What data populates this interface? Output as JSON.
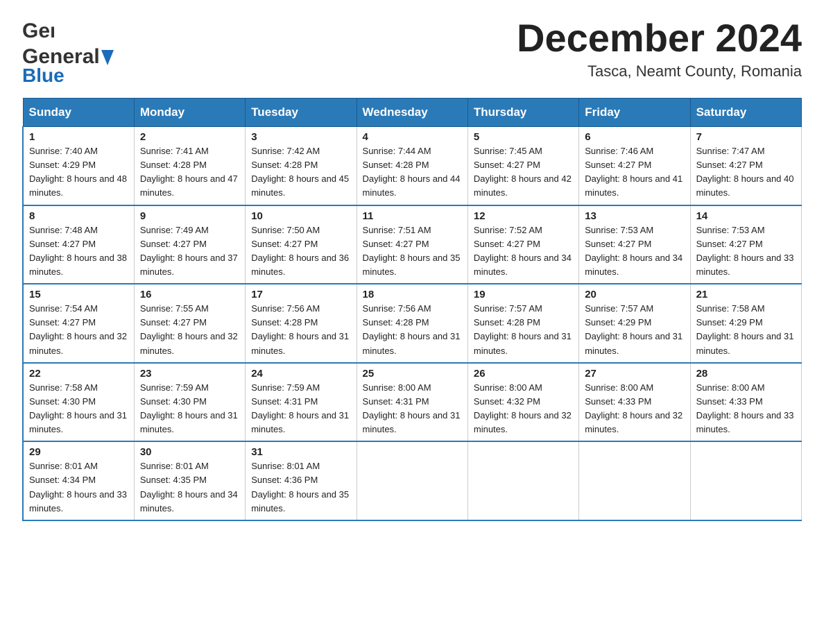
{
  "header": {
    "logo_line1": "General",
    "logo_line2": "Blue",
    "title": "December 2024",
    "subtitle": "Tasca, Neamt County, Romania"
  },
  "weekdays": [
    "Sunday",
    "Monday",
    "Tuesday",
    "Wednesday",
    "Thursday",
    "Friday",
    "Saturday"
  ],
  "weeks": [
    [
      {
        "day": "1",
        "sunrise": "7:40 AM",
        "sunset": "4:29 PM",
        "daylight": "8 hours and 48 minutes."
      },
      {
        "day": "2",
        "sunrise": "7:41 AM",
        "sunset": "4:28 PM",
        "daylight": "8 hours and 47 minutes."
      },
      {
        "day": "3",
        "sunrise": "7:42 AM",
        "sunset": "4:28 PM",
        "daylight": "8 hours and 45 minutes."
      },
      {
        "day": "4",
        "sunrise": "7:44 AM",
        "sunset": "4:28 PM",
        "daylight": "8 hours and 44 minutes."
      },
      {
        "day": "5",
        "sunrise": "7:45 AM",
        "sunset": "4:27 PM",
        "daylight": "8 hours and 42 minutes."
      },
      {
        "day": "6",
        "sunrise": "7:46 AM",
        "sunset": "4:27 PM",
        "daylight": "8 hours and 41 minutes."
      },
      {
        "day": "7",
        "sunrise": "7:47 AM",
        "sunset": "4:27 PM",
        "daylight": "8 hours and 40 minutes."
      }
    ],
    [
      {
        "day": "8",
        "sunrise": "7:48 AM",
        "sunset": "4:27 PM",
        "daylight": "8 hours and 38 minutes."
      },
      {
        "day": "9",
        "sunrise": "7:49 AM",
        "sunset": "4:27 PM",
        "daylight": "8 hours and 37 minutes."
      },
      {
        "day": "10",
        "sunrise": "7:50 AM",
        "sunset": "4:27 PM",
        "daylight": "8 hours and 36 minutes."
      },
      {
        "day": "11",
        "sunrise": "7:51 AM",
        "sunset": "4:27 PM",
        "daylight": "8 hours and 35 minutes."
      },
      {
        "day": "12",
        "sunrise": "7:52 AM",
        "sunset": "4:27 PM",
        "daylight": "8 hours and 34 minutes."
      },
      {
        "day": "13",
        "sunrise": "7:53 AM",
        "sunset": "4:27 PM",
        "daylight": "8 hours and 34 minutes."
      },
      {
        "day": "14",
        "sunrise": "7:53 AM",
        "sunset": "4:27 PM",
        "daylight": "8 hours and 33 minutes."
      }
    ],
    [
      {
        "day": "15",
        "sunrise": "7:54 AM",
        "sunset": "4:27 PM",
        "daylight": "8 hours and 32 minutes."
      },
      {
        "day": "16",
        "sunrise": "7:55 AM",
        "sunset": "4:27 PM",
        "daylight": "8 hours and 32 minutes."
      },
      {
        "day": "17",
        "sunrise": "7:56 AM",
        "sunset": "4:28 PM",
        "daylight": "8 hours and 31 minutes."
      },
      {
        "day": "18",
        "sunrise": "7:56 AM",
        "sunset": "4:28 PM",
        "daylight": "8 hours and 31 minutes."
      },
      {
        "day": "19",
        "sunrise": "7:57 AM",
        "sunset": "4:28 PM",
        "daylight": "8 hours and 31 minutes."
      },
      {
        "day": "20",
        "sunrise": "7:57 AM",
        "sunset": "4:29 PM",
        "daylight": "8 hours and 31 minutes."
      },
      {
        "day": "21",
        "sunrise": "7:58 AM",
        "sunset": "4:29 PM",
        "daylight": "8 hours and 31 minutes."
      }
    ],
    [
      {
        "day": "22",
        "sunrise": "7:58 AM",
        "sunset": "4:30 PM",
        "daylight": "8 hours and 31 minutes."
      },
      {
        "day": "23",
        "sunrise": "7:59 AM",
        "sunset": "4:30 PM",
        "daylight": "8 hours and 31 minutes."
      },
      {
        "day": "24",
        "sunrise": "7:59 AM",
        "sunset": "4:31 PM",
        "daylight": "8 hours and 31 minutes."
      },
      {
        "day": "25",
        "sunrise": "8:00 AM",
        "sunset": "4:31 PM",
        "daylight": "8 hours and 31 minutes."
      },
      {
        "day": "26",
        "sunrise": "8:00 AM",
        "sunset": "4:32 PM",
        "daylight": "8 hours and 32 minutes."
      },
      {
        "day": "27",
        "sunrise": "8:00 AM",
        "sunset": "4:33 PM",
        "daylight": "8 hours and 32 minutes."
      },
      {
        "day": "28",
        "sunrise": "8:00 AM",
        "sunset": "4:33 PM",
        "daylight": "8 hours and 33 minutes."
      }
    ],
    [
      {
        "day": "29",
        "sunrise": "8:01 AM",
        "sunset": "4:34 PM",
        "daylight": "8 hours and 33 minutes."
      },
      {
        "day": "30",
        "sunrise": "8:01 AM",
        "sunset": "4:35 PM",
        "daylight": "8 hours and 34 minutes."
      },
      {
        "day": "31",
        "sunrise": "8:01 AM",
        "sunset": "4:36 PM",
        "daylight": "8 hours and 35 minutes."
      },
      {
        "day": "",
        "sunrise": "",
        "sunset": "",
        "daylight": ""
      },
      {
        "day": "",
        "sunrise": "",
        "sunset": "",
        "daylight": ""
      },
      {
        "day": "",
        "sunrise": "",
        "sunset": "",
        "daylight": ""
      },
      {
        "day": "",
        "sunrise": "",
        "sunset": "",
        "daylight": ""
      }
    ]
  ]
}
